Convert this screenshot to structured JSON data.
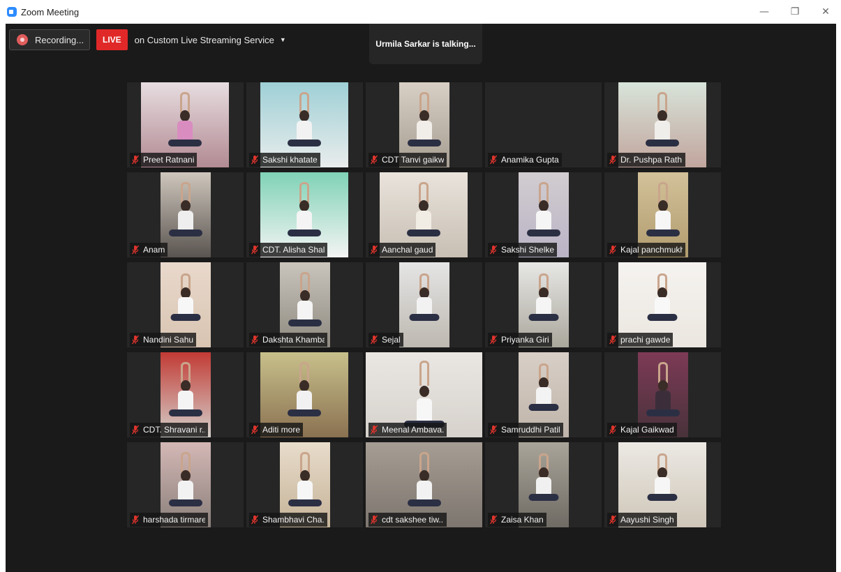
{
  "window": {
    "title": "Zoom Meeting",
    "controls": {
      "minimize": "—",
      "restore": "❐",
      "close": "✕"
    }
  },
  "toolbar": {
    "recording_label": "Recording...",
    "live_badge": "LIVE",
    "live_service": "on Custom Live Streaming Service",
    "live_caret": "▼"
  },
  "banner": {
    "talking": "Urmila Sarkar is talking..."
  },
  "icons": {
    "muted": "mic-muted-icon",
    "recording": "recording-icon"
  },
  "colors": {
    "live": "#e02828",
    "muted_mic": "#e0342c",
    "background": "#1a1a1a"
  },
  "participants": [
    {
      "name": "Preet Ratnani"
    },
    {
      "name": "Sakshi khatate"
    },
    {
      "name": "CDT Tanvi gaikw..."
    },
    {
      "name": "Anamika Gupta"
    },
    {
      "name": "Dr. Pushpa Rath..."
    },
    {
      "name": "Anam"
    },
    {
      "name": "CDT. Alisha Shal..."
    },
    {
      "name": "Aanchal gaud"
    },
    {
      "name": "Sakshi Shelke"
    },
    {
      "name": "Kajal panchmukh"
    },
    {
      "name": "Nandini Sahu"
    },
    {
      "name": "Dakshta Khambal"
    },
    {
      "name": "Sejal"
    },
    {
      "name": "Priyanka Giri"
    },
    {
      "name": "prachi gawde"
    },
    {
      "name": "CDT. Shravani r..."
    },
    {
      "name": "Aditi more"
    },
    {
      "name": "Meenal Ambava..."
    },
    {
      "name": "Samruddhi Patil"
    },
    {
      "name": "Kajal Gaikwad"
    },
    {
      "name": "harshada tirmare"
    },
    {
      "name": "Shambhavi Cha..."
    },
    {
      "name": "cdt sakshee tiw..."
    },
    {
      "name": "Zaisa Khan"
    },
    {
      "name": "Aayushi Singh"
    }
  ]
}
